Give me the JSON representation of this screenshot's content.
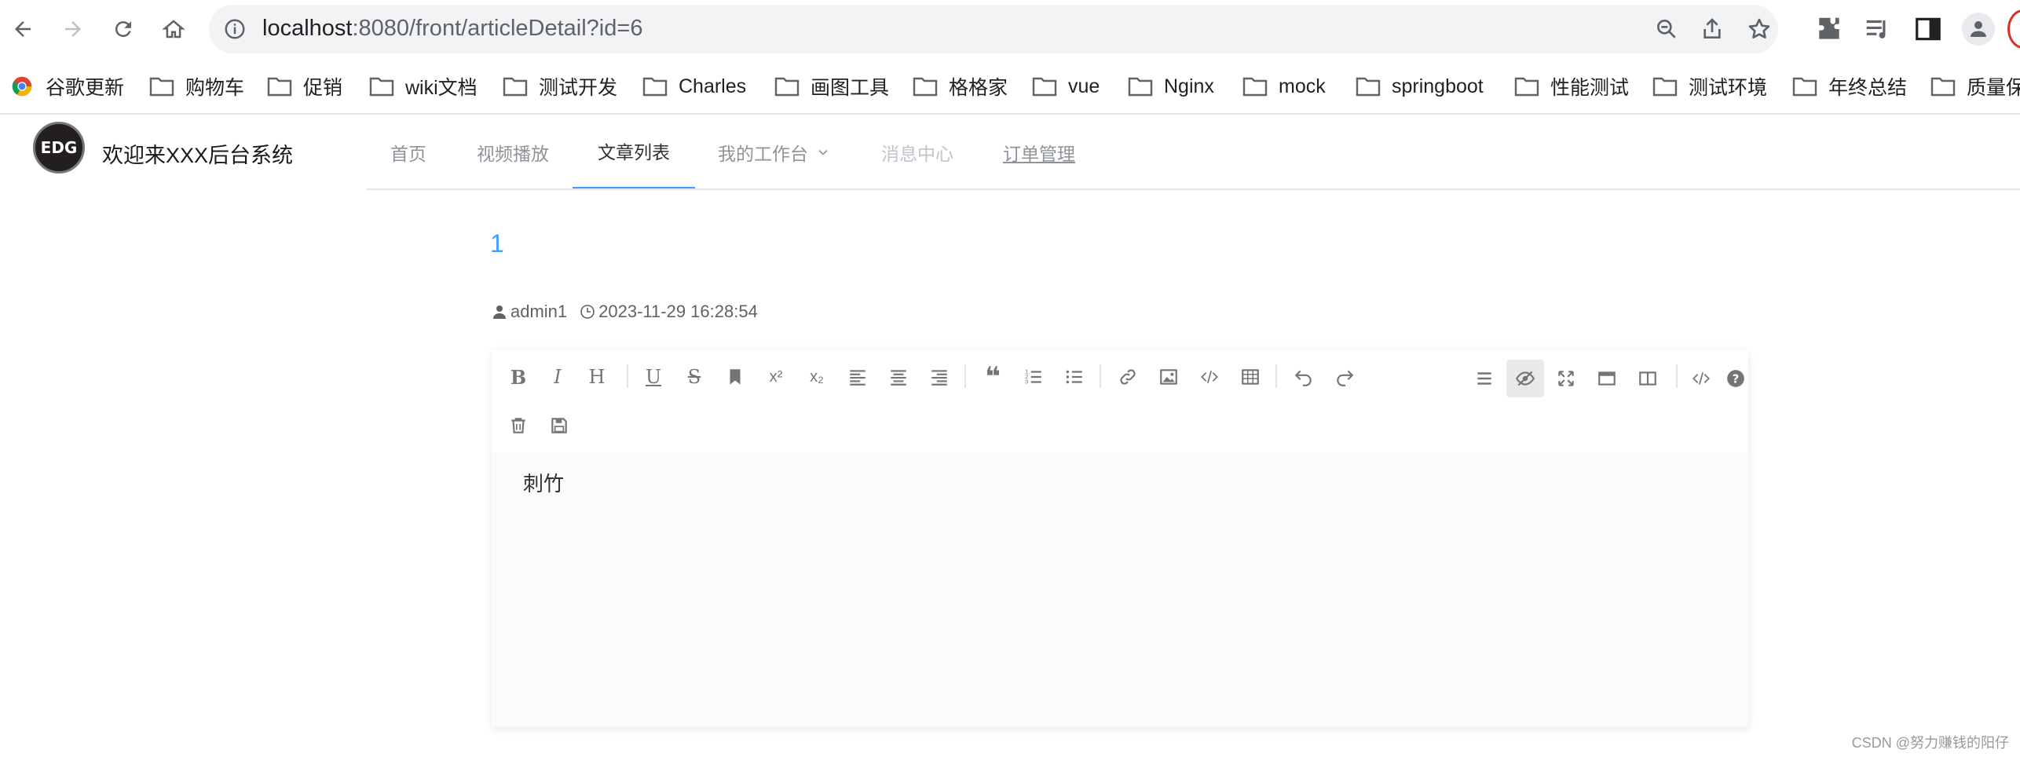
{
  "browser": {
    "url_host": "localhost",
    "url_rest": ":8080/front/articleDetail?id=6"
  },
  "bookmarks": [
    {
      "label": "谷歌更新",
      "icon": "chrome-icon"
    },
    {
      "label": "购物车",
      "icon": "folder-icon"
    },
    {
      "label": "促销",
      "icon": "folder-icon"
    },
    {
      "label": "wiki文档",
      "icon": "folder-icon"
    },
    {
      "label": "测试开发",
      "icon": "folder-icon"
    },
    {
      "label": "Charles",
      "icon": "folder-icon"
    },
    {
      "label": "画图工具",
      "icon": "folder-icon"
    },
    {
      "label": "格格家",
      "icon": "folder-icon"
    },
    {
      "label": "vue",
      "icon": "folder-icon"
    },
    {
      "label": "Nginx",
      "icon": "folder-icon"
    },
    {
      "label": "mock",
      "icon": "folder-icon"
    },
    {
      "label": "springboot",
      "icon": "folder-icon"
    },
    {
      "label": "性能测试",
      "icon": "folder-icon"
    },
    {
      "label": "测试环境",
      "icon": "folder-icon"
    },
    {
      "label": "年终总结",
      "icon": "folder-icon"
    },
    {
      "label": "质量保",
      "icon": "folder-icon"
    }
  ],
  "app": {
    "logo_text": "EDG",
    "title": "欢迎来XXX后台系统",
    "menu": [
      {
        "label": "首页",
        "state": "normal"
      },
      {
        "label": "视频播放",
        "state": "normal"
      },
      {
        "label": "文章列表",
        "state": "active"
      },
      {
        "label": "我的工作台",
        "state": "submenu"
      },
      {
        "label": "消息中心",
        "state": "disabled"
      },
      {
        "label": "订单管理",
        "state": "link"
      }
    ],
    "accent_color": "#409eff"
  },
  "article": {
    "title": "1",
    "author": "admin1",
    "datetime": "2023-11-29 16:28:54",
    "content": "刺竹"
  },
  "watermark": "CSDN @努力赚钱的阳仔"
}
